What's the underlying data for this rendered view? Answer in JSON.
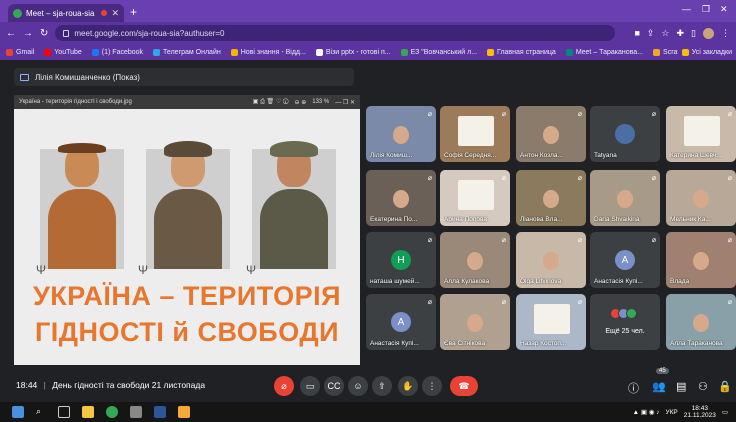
{
  "browser": {
    "tab_title": "Meet – sja-roua-sia",
    "new_tab": "+",
    "url": "meet.google.com/sja-roua-sia?authuser=0",
    "win_min": "—",
    "win_max": "❐",
    "win_close": "✕",
    "bookmarks": [
      "Gmail",
      "YouTube",
      "(1) Facebook",
      "Телеграм Онлайн",
      "Нові знання - Відд...",
      "Візи pptx - готові п...",
      "ЕЗ \"Вовчанський л...",
      "Главная страница",
      "Meet – Тараканова...",
      "Scratch - Imagine...",
      "Усі закладки"
    ],
    "bookmark_colors": [
      "#ea4335",
      "#ff0000",
      "#1877f2",
      "#29a9eb",
      "#f4b400",
      "#ffffff",
      "#34a853",
      "#fbbc04",
      "#00897b",
      "#f5a623",
      "#fbbc04"
    ]
  },
  "meet": {
    "presenter_label": "Лілія Комишанченко (Показ)",
    "slide": {
      "viewer_title": "Україна - територія гідності і свободи.jpg",
      "zoom": "133 %",
      "title_line1": "УКРАЇНА – ТЕРИТОРІЯ",
      "title_line2": "ГІДНОСТІ й СВОБОДИ"
    },
    "participants": [
      {
        "name": "Лілія Комиш...",
        "type": "photo",
        "bg": "#7a8aa8"
      },
      {
        "name": "Софія Середня...",
        "type": "paper",
        "bg": "#9b7b5a"
      },
      {
        "name": "Антон Козла...",
        "type": "photo",
        "bg": "#8a7b6a"
      },
      {
        "name": "Tatyana",
        "type": "avatar",
        "letter": "",
        "bg": "#3c4043",
        "avatar_color": "#4a6fa5"
      },
      {
        "name": "Катерина Шевч...",
        "type": "paper",
        "bg": "#c9b9a8"
      },
      {
        "name": "Екатерина По...",
        "type": "photo",
        "bg": "#6b6058"
      },
      {
        "name": "Арина Попова",
        "type": "paper",
        "bg": "#d6c9c0"
      },
      {
        "name": "Ліанова Вла...",
        "type": "photo",
        "bg": "#8b7a5e"
      },
      {
        "name": "Daria Shvaikina",
        "type": "photo",
        "bg": "#a89a88"
      },
      {
        "name": "Мельник Ка...",
        "type": "photo",
        "bg": "#b7a898"
      },
      {
        "name": "наташа шумей...",
        "type": "avatar",
        "letter": "Н",
        "bg": "#3c4043",
        "avatar_color": "#0f9d58"
      },
      {
        "name": "Алла Кулакова",
        "type": "photo",
        "bg": "#9a8878"
      },
      {
        "name": "Olga Litvinova",
        "type": "photo",
        "bg": "#c8b8a8"
      },
      {
        "name": "Анастасія Купі...",
        "type": "avatar",
        "letter": "А",
        "bg": "#3c4043",
        "avatar_color": "#7b8fc9"
      },
      {
        "name": "Влада",
        "type": "photo",
        "bg": "#a08070"
      },
      {
        "name": "Анастасія Купі...",
        "type": "avatar",
        "letter": "А",
        "bg": "#3c4043",
        "avatar_color": "#7b8fc9"
      },
      {
        "name": "Єва Сітнікова",
        "type": "photo",
        "bg": "#b0a090"
      },
      {
        "name": "Назар Костоп...",
        "type": "paper",
        "bg": "#aab8c8"
      },
      {
        "name": "",
        "type": "more",
        "bg": "#3c4043",
        "more_label": "Ещё 25 чел."
      },
      {
        "name": "Алла Тараканова",
        "type": "photo",
        "bg": "#8aa0a8"
      }
    ],
    "time": "18:44",
    "meeting_name": "День гідності та свободи 21 листопада",
    "people_count": "45"
  },
  "taskbar": {
    "lang": "УКР",
    "time": "18:43",
    "date": "21.11.2023"
  }
}
